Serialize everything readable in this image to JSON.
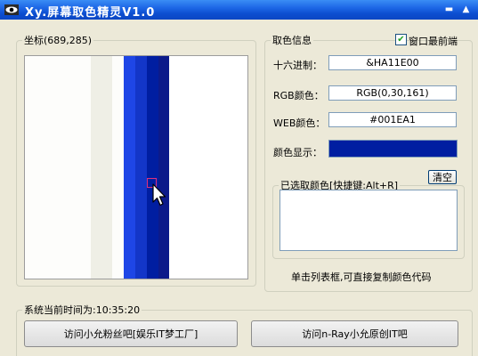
{
  "window": {
    "title": "Xy.屏幕取色精灵V1.0",
    "minimize_glyph": "▬",
    "topmost_glyph": "▲"
  },
  "coord": {
    "legend": "坐标(689,285)"
  },
  "preview": {
    "stripes": [
      {
        "color": "#fdfdfb"
      },
      {
        "color": "#efefe6"
      },
      {
        "color": "#fdfdfb"
      },
      {
        "color": "#1e46e6"
      },
      {
        "color": "#1336c8"
      },
      {
        "color": "#001ea1"
      },
      {
        "color": "#0c1a8a"
      },
      {
        "color": "#ffffff"
      }
    ]
  },
  "info": {
    "legend": "取色信息",
    "topmost_label": "窗口最前端",
    "topmost_checked": true,
    "hex_label": "十六进制：",
    "hex_value": "&HA11E00",
    "rgb_label": "RGB颜色：",
    "rgb_value": "RGB(0,30,161)",
    "web_label": "WEB颜色：",
    "web_value": "#001EA1",
    "display_label": "颜色显示：",
    "display_color": "#001ea1"
  },
  "picked": {
    "legend": "已选取颜色[快捷键:Alt+R]",
    "clear_label": "清空",
    "hint": "单击列表框,可直接复制颜色代码"
  },
  "time": {
    "legend": "系统当前时间为:10:35:20"
  },
  "links": {
    "fans_label": "访问小允粉丝吧[娱乐IT梦工厂]",
    "nray_label": "访问n-Ray小允原创IT吧"
  }
}
